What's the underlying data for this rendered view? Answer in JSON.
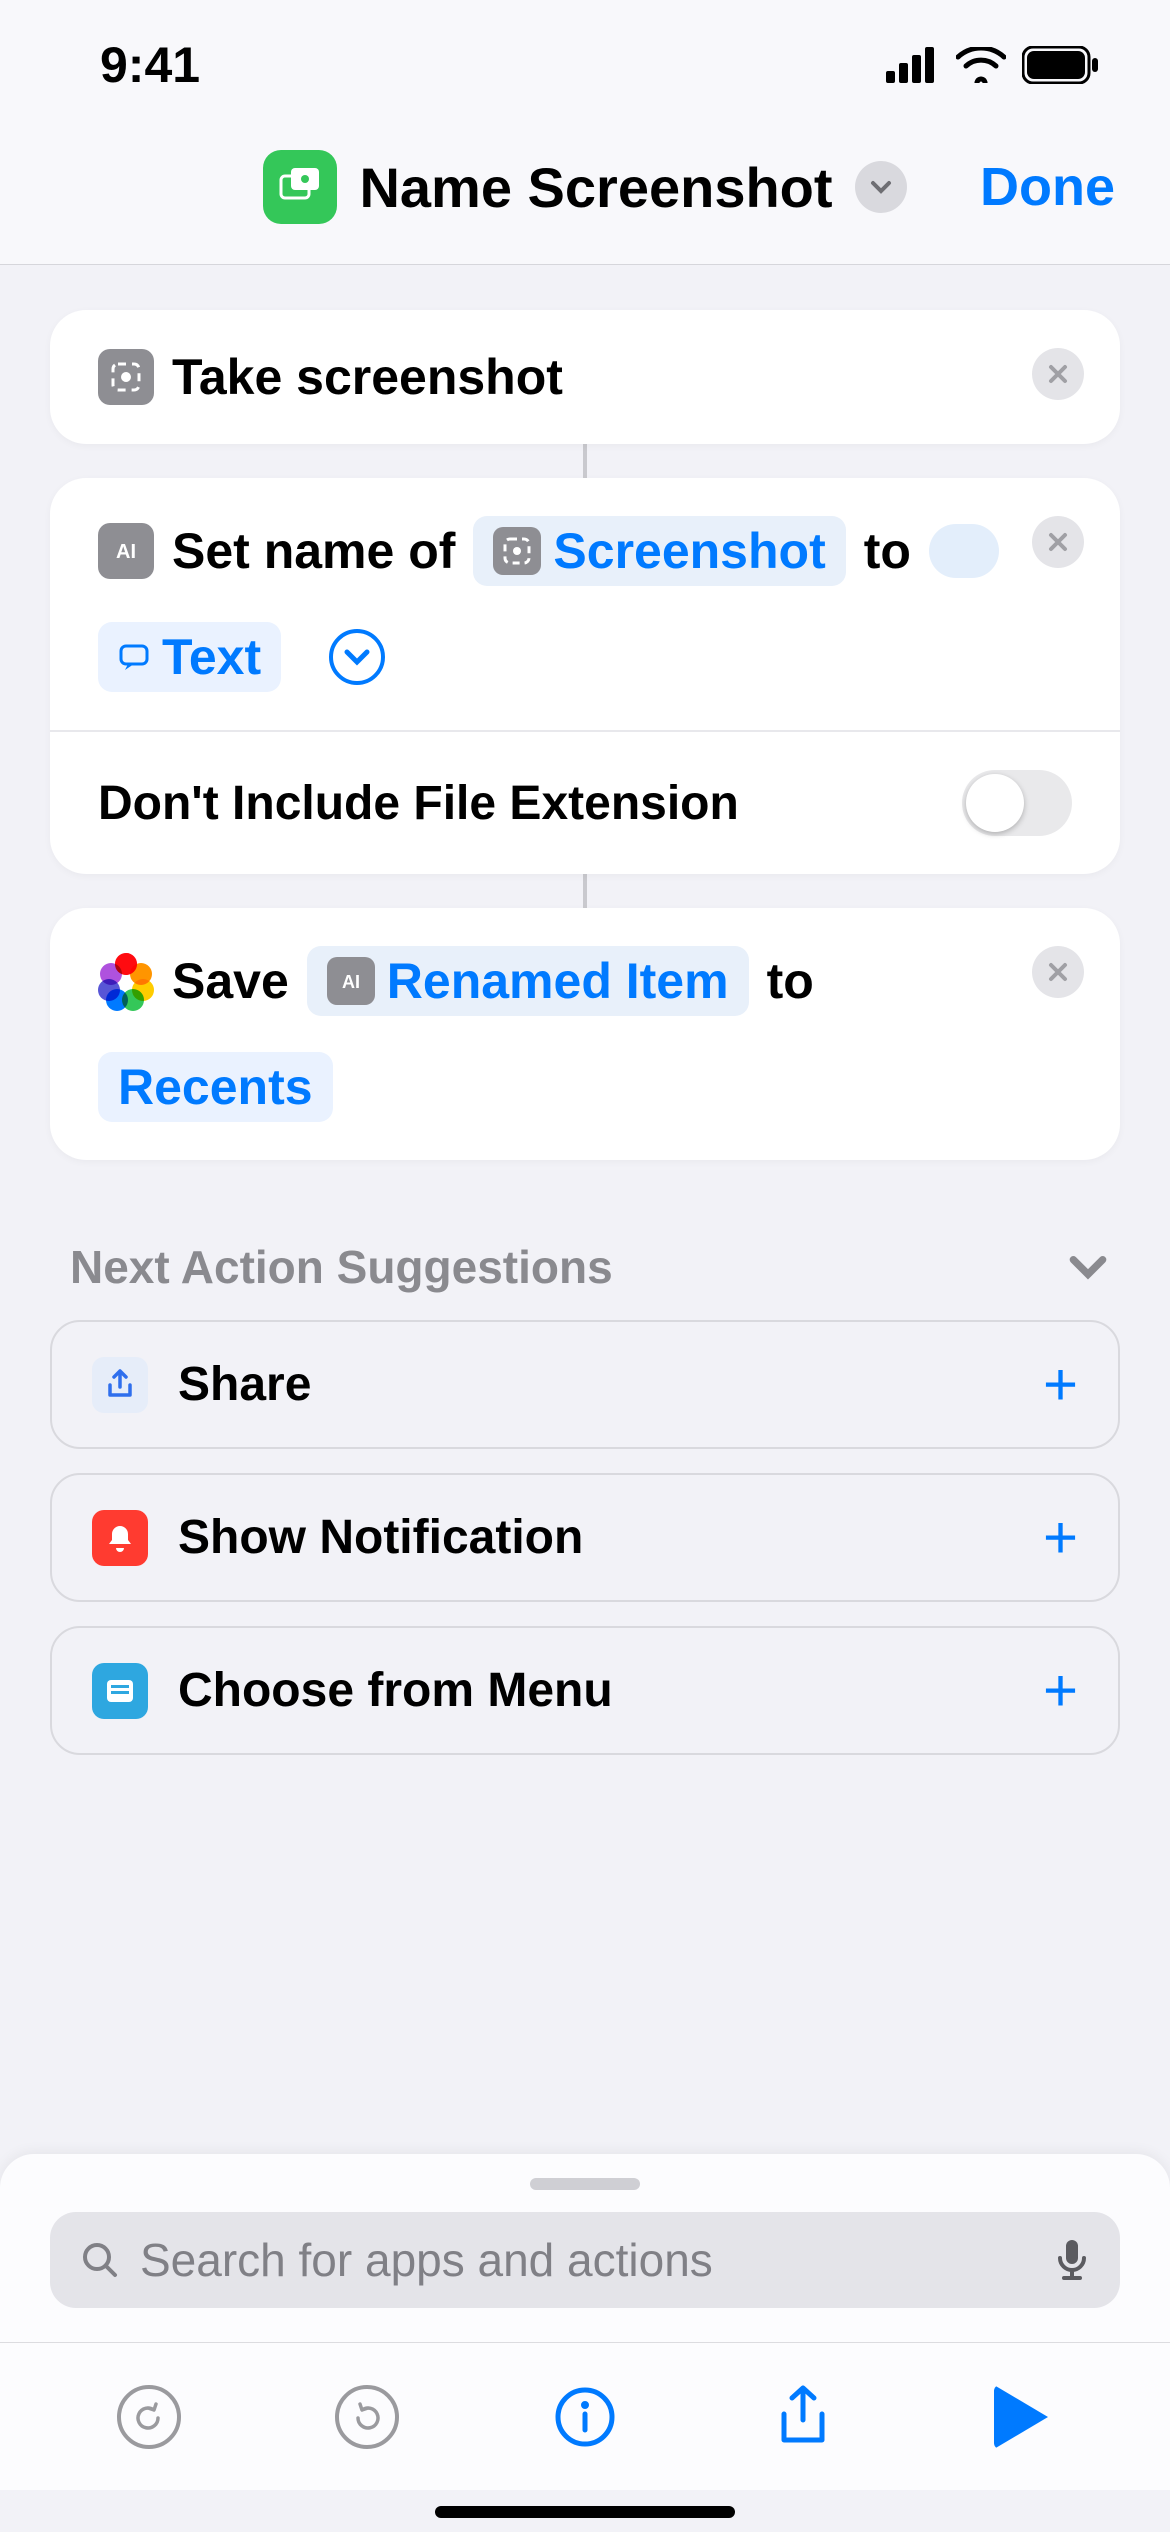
{
  "status": {
    "time": "9:41"
  },
  "header": {
    "title": "Name Screenshot",
    "done_label": "Done"
  },
  "actions": {
    "a1": {
      "label": "Take screenshot"
    },
    "a2": {
      "prefix": "Set name of",
      "var_label": "Screenshot",
      "mid": "to",
      "text_token": "Text",
      "option_label": "Don't Include File Extension"
    },
    "a3": {
      "prefix": "Save",
      "var_label": "Renamed Item",
      "mid": "to",
      "album_token": "Recents"
    }
  },
  "suggestions": {
    "header": "Next Action Suggestions",
    "items": [
      {
        "label": "Share"
      },
      {
        "label": "Show Notification"
      },
      {
        "label": "Choose from Menu"
      }
    ]
  },
  "search": {
    "placeholder": "Search for apps and actions"
  }
}
